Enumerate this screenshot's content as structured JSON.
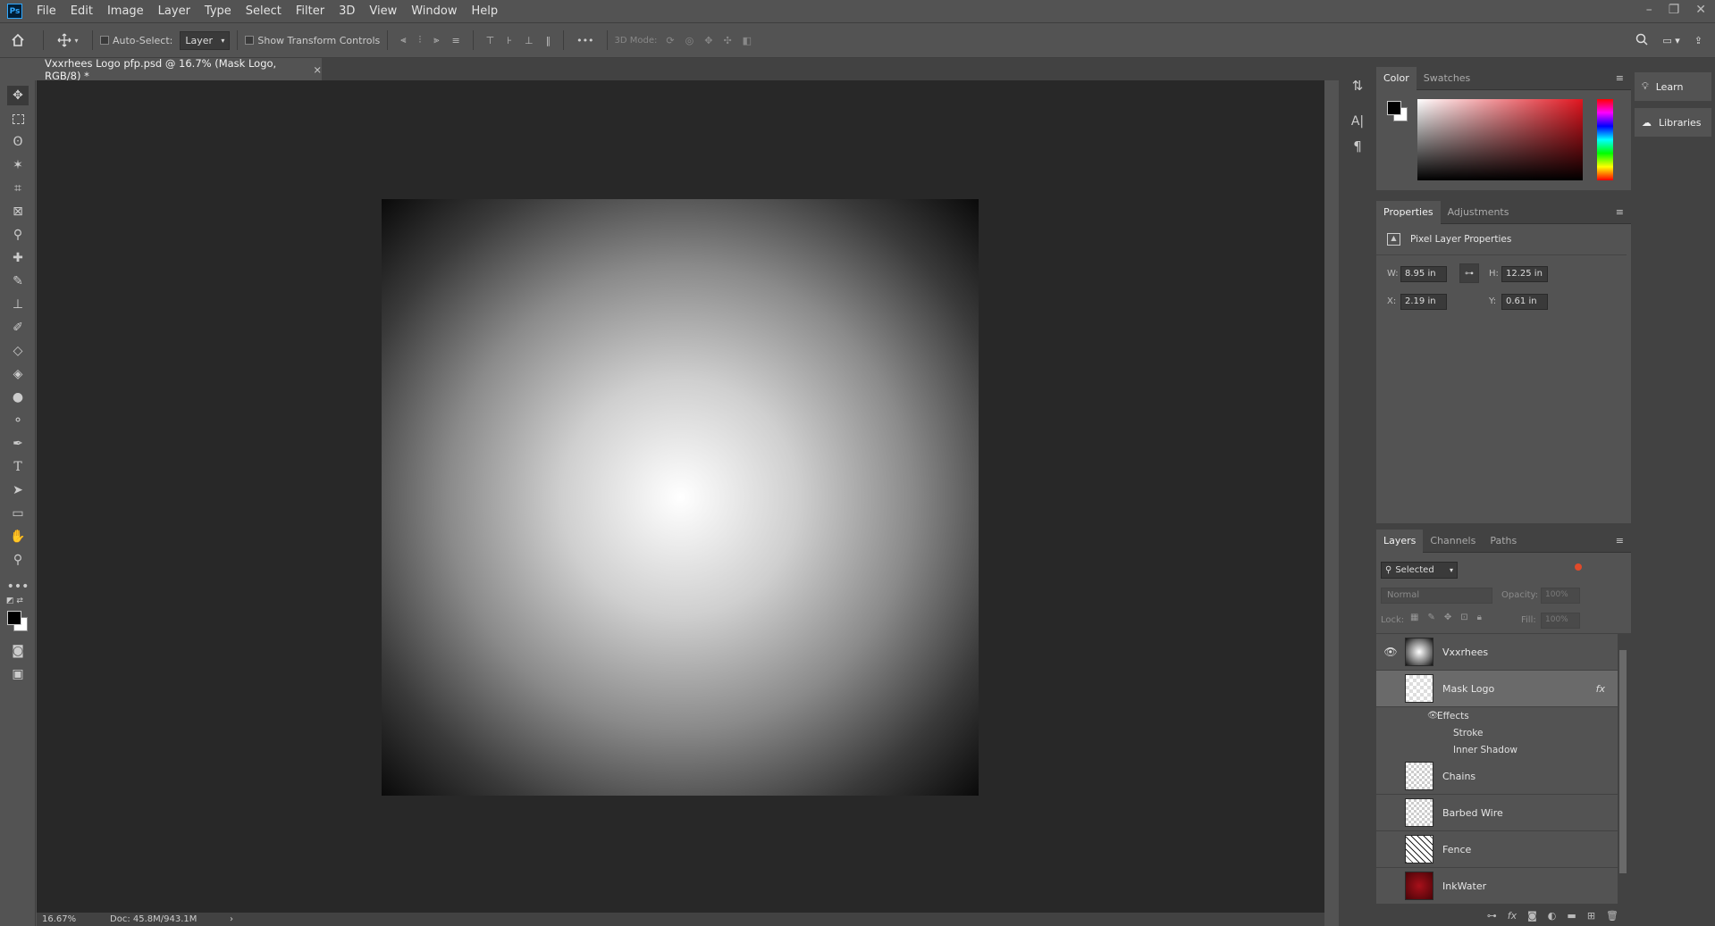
{
  "app": {
    "logo_text": "Ps"
  },
  "menu": [
    "File",
    "Edit",
    "Image",
    "Layer",
    "Type",
    "Select",
    "Filter",
    "3D",
    "View",
    "Window",
    "Help"
  ],
  "window_controls": {
    "minimize": "–",
    "restore": "❐",
    "close": "✕"
  },
  "options_bar": {
    "auto_select_label": "Auto-Select:",
    "auto_select_target": "Layer",
    "show_transform_label": "Show Transform Controls",
    "more_label": "•••",
    "mode_3d_label": "3D Mode:"
  },
  "document": {
    "tab_title": "Vxxrhees Logo pfp.psd @ 16.7% (Mask Logo, RGB/8) *",
    "close_glyph": "×"
  },
  "status": {
    "zoom": "16.67%",
    "doc_size": "Doc: 45.8M/943.1M",
    "arrow": "›"
  },
  "color_panel": {
    "tabs": [
      "Color",
      "Swatches"
    ],
    "foreground": "#000000",
    "background": "#ffffff"
  },
  "properties_panel": {
    "tabs": [
      "Properties",
      "Adjustments"
    ],
    "heading": "Pixel Layer Properties",
    "w_label": "W:",
    "w_value": "8.95 in",
    "h_label": "H:",
    "h_value": "12.25 in",
    "x_label": "X:",
    "x_value": "2.19 in",
    "y_label": "Y:",
    "y_value": "0.61 in"
  },
  "layers_panel": {
    "tabs": [
      "Layers",
      "Channels",
      "Paths"
    ],
    "filter": "Selected",
    "blend_mode": "Normal",
    "opacity_label": "Opacity:",
    "opacity_value": "100%",
    "lock_label": "Lock:",
    "fill_label": "Fill:",
    "fill_value": "100%",
    "layers": [
      {
        "name": "Vxxrhees",
        "visible": true
      },
      {
        "name": "Mask Logo",
        "visible": false,
        "selected": true,
        "fx": "fx"
      },
      {
        "name": "Chains",
        "visible": false
      },
      {
        "name": "Barbed Wire",
        "visible": false
      },
      {
        "name": "Fence",
        "visible": false
      },
      {
        "name": "InkWater",
        "visible": false
      }
    ],
    "effects": {
      "label": "Effects",
      "items": [
        "Stroke",
        "Inner Shadow"
      ]
    }
  },
  "right_dock": {
    "learn": "Learn",
    "libraries": "Libraries"
  }
}
